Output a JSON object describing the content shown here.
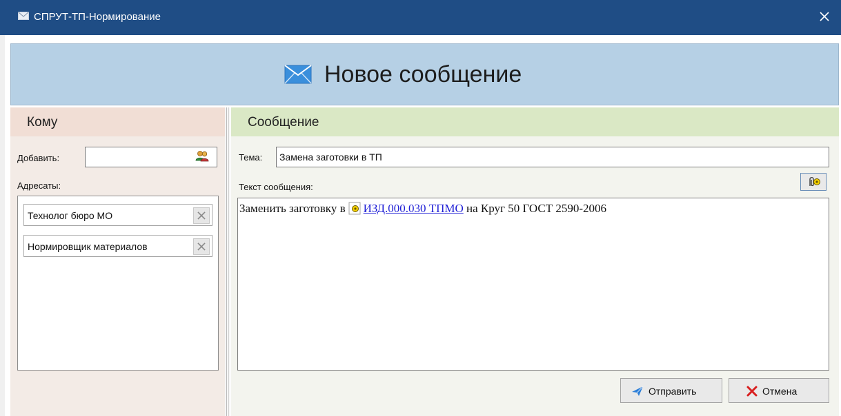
{
  "window": {
    "title": "СПРУТ-ТП-Нормирование",
    "close_icon": "close-icon"
  },
  "banner": {
    "icon": "envelope-icon",
    "title": "Новое сообщение"
  },
  "recipients_panel": {
    "title": "Кому",
    "add_label": "Добавить:",
    "add_value": "",
    "add_button_icon": "users-icon",
    "list_label": "Адресаты:",
    "items": [
      {
        "label": "Технолог бюро МО",
        "remove_icon": "remove-icon"
      },
      {
        "label": "Нормировщик материалов",
        "remove_icon": "remove-icon"
      }
    ]
  },
  "message_panel": {
    "title": "Сообщение",
    "subject_label": "Тема:",
    "subject_value": "Замена заготовки в ТП",
    "body_label": "Текст сообщения:",
    "attach_button_icon": "attach-object-icon",
    "body": {
      "prefix": "Заменить заготовку в",
      "link_icon": "object-link-icon",
      "link_text": "ИЗД.000.030 ТПМО",
      "suffix": " на Круг 50 ГОСТ 2590-2006"
    }
  },
  "actions": {
    "send_label": "Отправить",
    "send_icon": "send-icon",
    "cancel_label": "Отмена",
    "cancel_icon": "cancel-icon"
  },
  "colors": {
    "titlebar": "#1f4d85",
    "banner": "#b6d0e5",
    "recipients_header": "#f1ded5",
    "message_header": "#dae8c5",
    "link": "#1f1fd6",
    "send_accent": "#2e7fd8",
    "cancel_accent": "#d81f1f"
  }
}
